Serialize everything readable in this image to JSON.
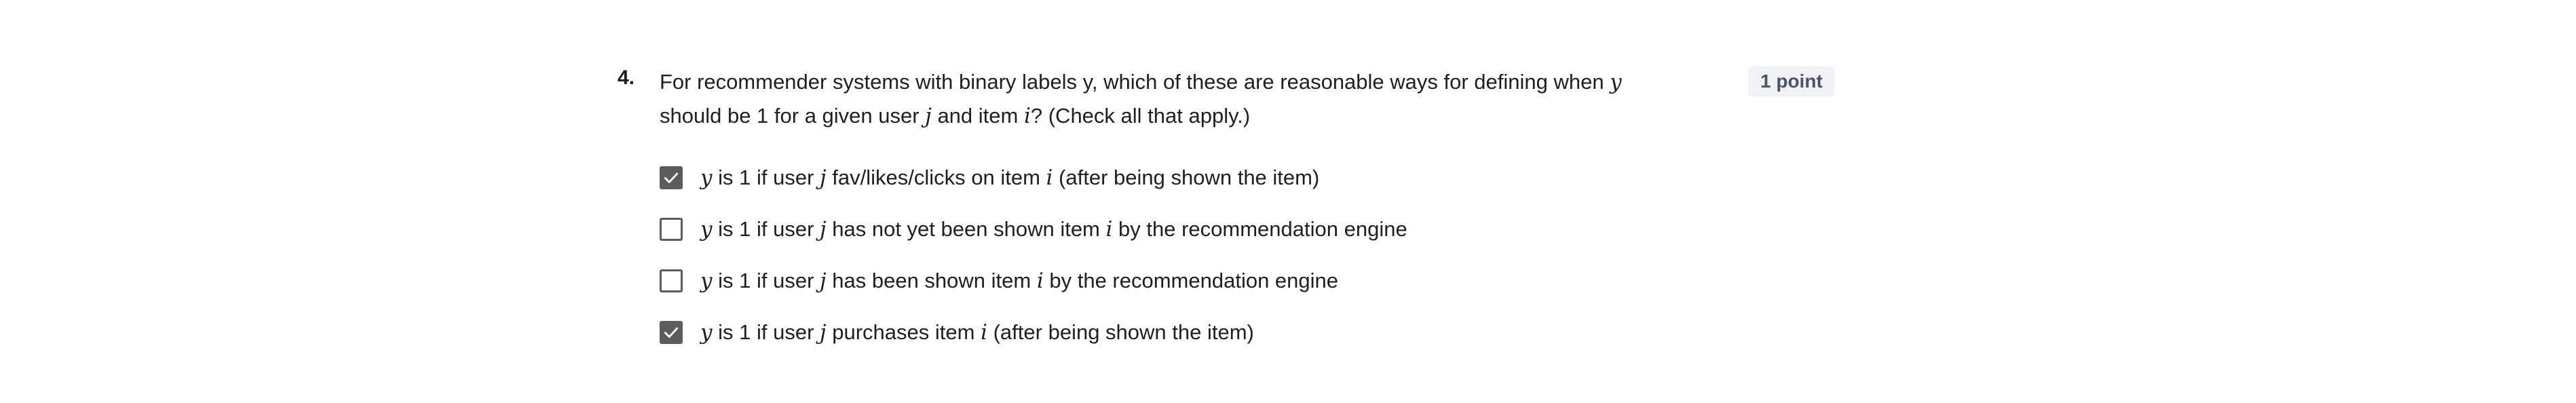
{
  "question": {
    "number": "4.",
    "text_part1": "For recommender systems with binary labels y, which of these are reasonable ways for defining when ",
    "text_var_y": "y",
    "text_part2": " should be 1 for a given user ",
    "text_var_j": "j",
    "text_part3": " and item ",
    "text_var_i": "i",
    "text_part4": "? (Check all that apply.)",
    "points": "1 point"
  },
  "options": [
    {
      "checked": true,
      "var_y": "y",
      "part1": " is 1 if user ",
      "var_j": "j",
      "part2": " fav/likes/clicks on item ",
      "var_i": "i",
      "part3": " (after being shown the item)"
    },
    {
      "checked": false,
      "var_y": "y",
      "part1": " is 1 if user ",
      "var_j": "j",
      "part2": " has not yet been shown item ",
      "var_i": "i",
      "part3": " by the recommendation engine"
    },
    {
      "checked": false,
      "var_y": "y",
      "part1": " is 1 if user ",
      "var_j": "j",
      "part2": " has been shown item ",
      "var_i": "i",
      "part3": " by the recommendation engine"
    },
    {
      "checked": true,
      "var_y": "y",
      "part1": " is 1 if user ",
      "var_j": "j",
      "part2": " purchases item ",
      "var_i": "i",
      "part3": " (after being shown the item)"
    }
  ],
  "colors": {
    "checkbox": "#5c5c5c",
    "badge_bg": "#f0f2f6",
    "badge_text": "#4b5563",
    "text": "#1f1f1f"
  },
  "icons": {
    "checked": "checkmark-icon"
  }
}
